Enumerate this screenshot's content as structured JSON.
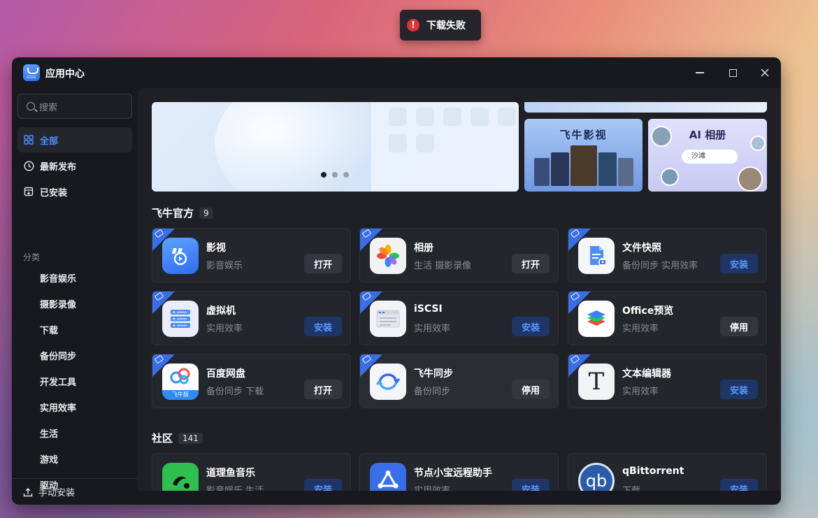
{
  "toast": {
    "message": "下载失败",
    "icon": "error-icon",
    "color": "#e0303a"
  },
  "window": {
    "title": "应用中心",
    "logo_text": "STORE"
  },
  "sidebar": {
    "search_placeholder": "搜索",
    "nav": [
      {
        "label": "全部",
        "icon": "grid-icon",
        "active": true
      },
      {
        "label": "最新发布",
        "icon": "clock-icon",
        "active": false
      },
      {
        "label": "已安装",
        "icon": "installed-box-icon",
        "active": false
      }
    ],
    "category_label": "分类",
    "categories": [
      "影音娱乐",
      "摄影录像",
      "下载",
      "备份同步",
      "开发工具",
      "实用效率",
      "生活",
      "游戏",
      "驱动"
    ],
    "manual_install": "手动安装"
  },
  "banners": {
    "movie_title": "飞牛影视",
    "ai_title": "AI 相册",
    "ai_search_text": "沙滩",
    "carousel_active": 1
  },
  "official": {
    "title": "飞牛官方",
    "count": "9",
    "apps": [
      {
        "name": "影视",
        "category": "影音娱乐",
        "action": "打开"
      },
      {
        "name": "相册",
        "category": "生活 摄影录像",
        "action": "打开"
      },
      {
        "name": "文件快照",
        "category": "备份同步 实用效率",
        "action": "安装"
      },
      {
        "name": "虚拟机",
        "category": "实用效率",
        "action": "安装"
      },
      {
        "name": "iSCSI",
        "category": "实用效率",
        "action": "安装"
      },
      {
        "name": "Office预览",
        "category": "实用效率",
        "action": "停用"
      },
      {
        "name": "百度网盘",
        "category": "备份同步 下载",
        "action": "打开",
        "icon_caption": "飞牛版"
      },
      {
        "name": "飞牛同步",
        "category": "备份同步",
        "action": "停用"
      },
      {
        "name": "文本编辑器",
        "category": "实用效率",
        "action": "安装"
      }
    ]
  },
  "community": {
    "title": "社区",
    "count": "141",
    "apps": [
      {
        "name": "道理鱼音乐",
        "category": "影音娱乐 生活",
        "action": "安装"
      },
      {
        "name": "节点小宝远程助手",
        "category": "实用效率",
        "action": "安装"
      },
      {
        "name": "qBittorrent",
        "category": "下载",
        "action": "安装",
        "icon_text": "qb"
      }
    ]
  },
  "colors": {
    "accent": "#4d8dff",
    "install_bg": "#1f3566",
    "corner_badge": "#3a6ee8"
  }
}
